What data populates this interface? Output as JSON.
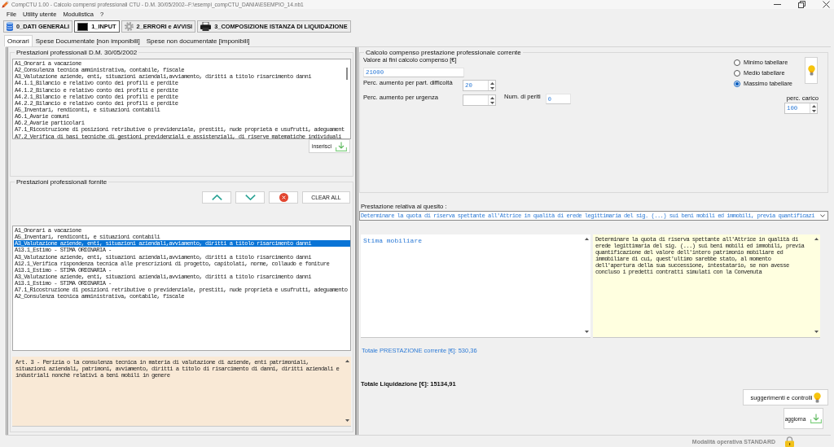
{
  "window": {
    "title": "CompCTU 1.00 - Calcolo compensi professionali CTU - D.M. 30/05/2002--F:\\esempi_compCTU_DANIA\\ESEMPIO_14.nb1"
  },
  "menu": [
    {
      "label": "File"
    },
    {
      "label": "Utility utente"
    },
    {
      "label": "Modulistica"
    },
    {
      "label": "?"
    }
  ],
  "tabs": [
    {
      "label": "0_DATI GENERALI",
      "selected": false
    },
    {
      "label": "1_INPUT",
      "selected": true
    },
    {
      "label": "2_ERRORI e AVVISI",
      "selected": false
    },
    {
      "label": "3_COMPOSIZIONE ISTANZA DI LIQUIDAZIONE",
      "selected": false
    }
  ],
  "subtabs": [
    {
      "label": "Onorari",
      "selected": true
    },
    {
      "label": "Spese Documentate [non imponibili]",
      "selected": false
    },
    {
      "label": "Spese non documentate [imponibili]",
      "selected": false
    }
  ],
  "catalog": {
    "title": "Prestazioni professionali D.M. 30/05/2002",
    "items": [
      {
        "text": "A1_Onorari a vacazione",
        "selected": false
      },
      {
        "text": "A2_Consulenza tecnica amministrativa, contabile, fiscale",
        "selected": false
      },
      {
        "text": "A3_Valutazione aziende, enti, situazioni aziendali,avviamento, diritti a titolo risarcimento danni",
        "selected": false
      },
      {
        "text": "A4.1.1_Bilancio e relativo conto dei profili e perdite",
        "selected": false
      },
      {
        "text": "A4.1.2_Bilancio e relativo conto dei profili e perdite",
        "selected": false
      },
      {
        "text": "A4.2.1_Bilancio e relativo conto dei profili e perdite",
        "selected": false
      },
      {
        "text": "A4.2.2_Bilancio e relativo conto dei profili e perdite",
        "selected": false
      },
      {
        "text": "A5_Inventari, rendiconti, e situazioni contabili",
        "selected": false
      },
      {
        "text": "A6.1_Avarie comuni",
        "selected": false
      },
      {
        "text": "A6.2_Avarie particolari",
        "selected": false
      },
      {
        "text": "A7.1_Ricostruzione di posizioni retributive o previdenziale, prestiti, nude proprietà e usufrutti, adeguament",
        "selected": false
      },
      {
        "text": "A7.2_Verifica di basi tecniche di gestioni previdenziali e assistenziali, di riserve matematiche individuali",
        "selected": false
      }
    ],
    "insert_button": "inserisci"
  },
  "provided": {
    "title": "Prestazioni professionali fornite",
    "clear_button": "CLEAR ALL",
    "items": [
      {
        "text": "A1_Onorari a vacazione",
        "selected": false
      },
      {
        "text": "A5_Inventari, rendiconti, e situazioni contabili",
        "selected": false
      },
      {
        "text": "A3_Valutazione aziende, enti, situazioni aziendali,avviamento, diritti a titolo risarcimento danni",
        "selected": true
      },
      {
        "text": "A13.1_Estimo - STIMA ORDINARIA -",
        "selected": false
      },
      {
        "text": "A3_Valutazione aziende, enti, situazioni aziendali,avviamento, diritti a titolo risarcimento danni",
        "selected": false
      },
      {
        "text": "A12.1_Verifica rispondenza tecnica alle prescrizioni di progetto, capitolati, norme, collaudo e foniture",
        "selected": false
      },
      {
        "text": "A13.1_Estimo - STIMA ORDINARIA -",
        "selected": false
      },
      {
        "text": "A3_Valutazione aziende, enti, situazioni aziendali,avviamento, diritti a titolo risarcimento danni",
        "selected": false
      },
      {
        "text": "A13.1_Estimo - STIMA ORDINARIA -",
        "selected": false
      },
      {
        "text": "A7.1_Ricostruzione di posizioni retributive o previdenziale, prestiti, nude proprietà e usufrutti, adeguamento",
        "selected": false
      },
      {
        "text": "A2_Consulenza tecnica amministrativa, contabile, fiscale",
        "selected": false
      }
    ],
    "description": "Art. 3 - Perizia o la consulenza tecnica in materia di valutazione di aziende, enti patrimoniali, situazioni aziendali, patrimoni, avviamento, diritti a titolo di risarcimento di danni, diritti aziendali e industriali nonchè relativi a beni mobili in genere"
  },
  "calc": {
    "title": "Calcolo compenso prestazione professionale corrente",
    "value_label": "Valore ai fini calcolo compenso [€]",
    "value": "21000",
    "difficulty_label": "Perc. aumento per part. difficoltà",
    "difficulty": "20",
    "urgency_label": "Perc. aumento per urgenza",
    "experts_label": "Num. di periti",
    "experts": "0",
    "levels": [
      {
        "label": "Minimo tabellare",
        "selected": false
      },
      {
        "label": "Medio tabellare",
        "selected": false
      },
      {
        "label": "Massimo tabellare",
        "selected": true
      }
    ],
    "load_label": "perc. carico",
    "load": "100"
  },
  "question": {
    "label": "Prestazione relativa al quesito :",
    "selection": "Determinare la quota di riserva spettante all'Attrice in qualità di erede legittimaria del sig. (...) sui beni mobili ed immobili, previa quantificazi",
    "service": "Stima mobiliare",
    "text": "Determinare la quota di riserva spettante all'Attrice in qualità di erede legittimaria del sig. (...) sui beni mobili ed immobili, previa quantificazione del valore dell'intero patrimonio mobiliare ed immobiliare di cui, quest'ultimo sarebbe stato, al momento dell'apertura della sua successione, intestatario, se non avesse concluso i predetti contratti simulati con la Convenuta"
  },
  "totals": {
    "current": "Totale PRESTAZIONE corrente [€]: 530,36",
    "liquidation": "Totale Liquidazione [€]: 15134,91"
  },
  "actions": {
    "suggestions": "suggerimenti e controlli",
    "update": "aggiorna"
  },
  "status_bar": {
    "mode": "Modalità operativa STANDARD"
  }
}
